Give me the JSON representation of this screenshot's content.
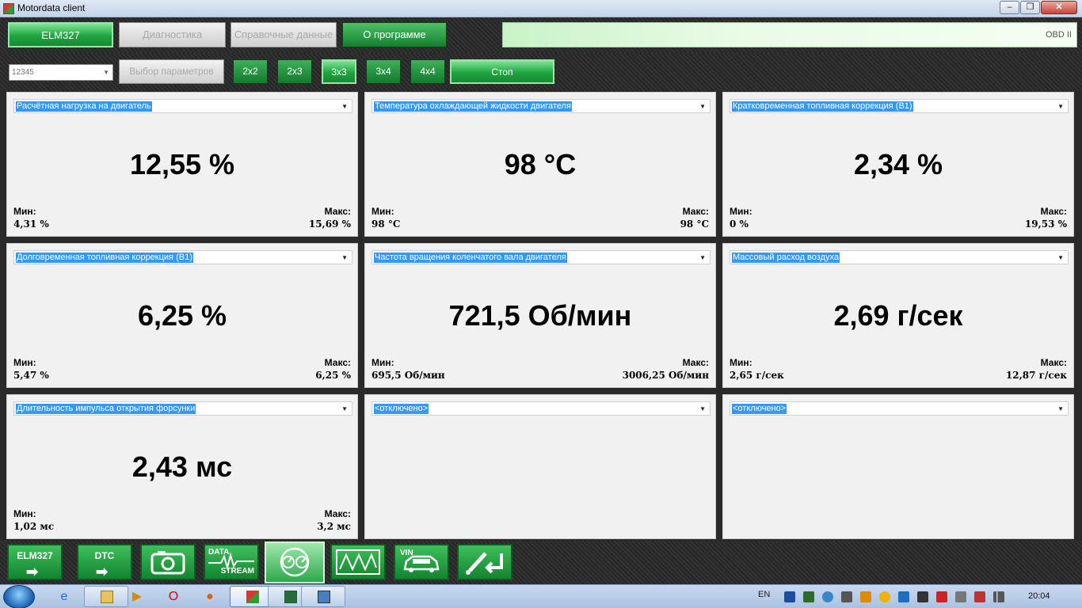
{
  "window": {
    "title": "Motordata client",
    "controls": {
      "minimize": "–",
      "maximize": "❐",
      "close": "✕"
    }
  },
  "menu": {
    "items": [
      "ELM327",
      "Диагностика",
      "Справочные данные",
      "О программе"
    ],
    "protocol": "OBD II"
  },
  "toolbar": {
    "profile_value": "12345",
    "param_button": "Выбор параметров",
    "grid_buttons": [
      "2x2",
      "2x3",
      "3x3",
      "3x4",
      "4x4"
    ],
    "active_grid": "3x3",
    "stop_button": "Стоп"
  },
  "panels": [
    {
      "param": "Расчётная нагрузка на двигатель",
      "value": "12,55 %",
      "min_label": "Мин:",
      "min": "4,31 %",
      "max_label": "Макс:",
      "max": "15,69 %"
    },
    {
      "param": "Температура охлаждающей жидкости двигателя",
      "value": "98 °C",
      "min_label": "Мин:",
      "min": "98 °C",
      "max_label": "Макс:",
      "max": "98 °C"
    },
    {
      "param": "Кратковременная топливная коррекция (B1)",
      "value": "2,34 %",
      "min_label": "Мин:",
      "min": "0 %",
      "max_label": "Макс:",
      "max": "19,53 %"
    },
    {
      "param": "Долговременная топливная коррекция (B1)",
      "value": "6,25 %",
      "min_label": "Мин:",
      "min": "5,47 %",
      "max_label": "Макс:",
      "max": "6,25 %"
    },
    {
      "param": "Частота вращения коленчатого вала двигателя",
      "value": "721,5 Об/мин",
      "min_label": "Мин:",
      "min": "695,5 Об/мин",
      "max_label": "Макс:",
      "max": "3006,25 Об/мин"
    },
    {
      "param": "Массовый расход воздуха",
      "value": "2,69 г/сек",
      "min_label": "Мин:",
      "min": "2,65 г/сек",
      "max_label": "Макс:",
      "max": "12,87 г/сек"
    },
    {
      "param": "Длительность импульса открытия форсунки",
      "value": "2,43 мс",
      "min_label": "Мин:",
      "min": "1,02 мс",
      "max_label": "Макс:",
      "max": "3,2 мс"
    },
    {
      "param": "<отключено>"
    },
    {
      "param": "<отключено>"
    }
  ],
  "iconbar": {
    "elm_label": "ELM327",
    "dtc_label": "DTC",
    "stream_line1": "DATA",
    "stream_line2": "STREAM",
    "vin_label": "VIN",
    "active_item": "gauges"
  },
  "taskbar": {
    "language": "EN",
    "clock": "20:04"
  },
  "colors": {
    "accent_green": "#1fa440",
    "selection_blue": "#3399ff",
    "panel_bg": "#f1f1f1"
  }
}
